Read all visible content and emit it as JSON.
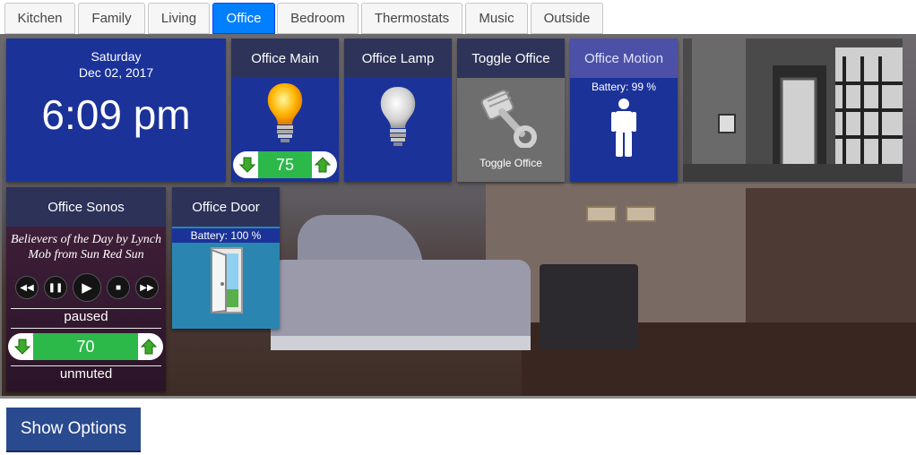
{
  "tabs": [
    {
      "label": "Kitchen"
    },
    {
      "label": "Family"
    },
    {
      "label": "Living"
    },
    {
      "label": "Office"
    },
    {
      "label": "Bedroom"
    },
    {
      "label": "Thermostats"
    },
    {
      "label": "Music"
    },
    {
      "label": "Outside"
    }
  ],
  "active_tab": "Office",
  "clock": {
    "day": "Saturday",
    "date": "Dec 02, 2017",
    "time": "6:09 pm"
  },
  "office_main": {
    "title": "Office Main",
    "level": "75",
    "state": "on"
  },
  "office_lamp": {
    "title": "Office Lamp",
    "state": "off"
  },
  "toggle_office": {
    "title": "Toggle Office",
    "label": "Toggle Office"
  },
  "office_motion": {
    "title": "Office Motion",
    "battery": "Battery: 99 %",
    "state": "active"
  },
  "office_sonos": {
    "title": "Office Sonos",
    "track": "Believers of the Day by Lynch Mob from Sun Red Sun",
    "status": "paused",
    "volume": "70",
    "mute": "unmuted"
  },
  "office_door": {
    "title": "Office Door",
    "battery": "Battery: 100 %",
    "state": "open"
  },
  "show_options": "Show Options",
  "colors": {
    "tile_blue": "#1b3299",
    "tab_active": "#007fff",
    "level_green": "#2db84a",
    "header_dark": "#2a3058"
  },
  "icons": {
    "level_down": "green-down-arrow-icon",
    "level_up": "green-up-arrow-icon",
    "bulb_on": "lit-bulb-icon",
    "bulb_off": "unlit-bulb-icon",
    "toggle": "piston-icon",
    "motion": "person-icon",
    "door": "open-door-icon"
  }
}
